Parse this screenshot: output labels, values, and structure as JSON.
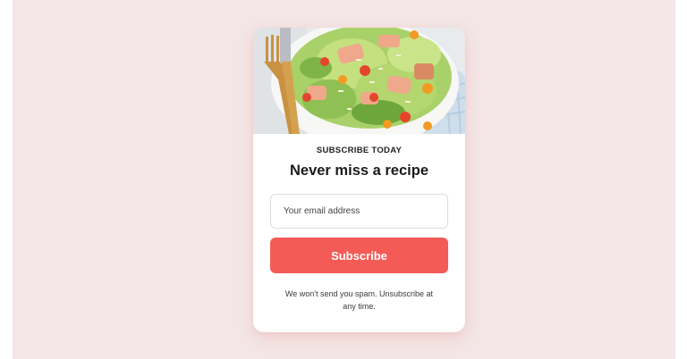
{
  "hero": {
    "icon": "salad-photo",
    "alt": "Salad with salmon, lettuce and cherry tomatoes"
  },
  "eyebrow": "SUBSCRIBE TODAY",
  "title": "Never miss a recipe",
  "email": {
    "placeholder": "Your email address",
    "value": ""
  },
  "subscribe_label": "Subscribe",
  "disclaimer": "We won't send you spam. Unsubscribe at any time.",
  "colors": {
    "page_bg": "#f3e6e6",
    "accent": "#f45b56",
    "card_bg": "#ffffff"
  }
}
